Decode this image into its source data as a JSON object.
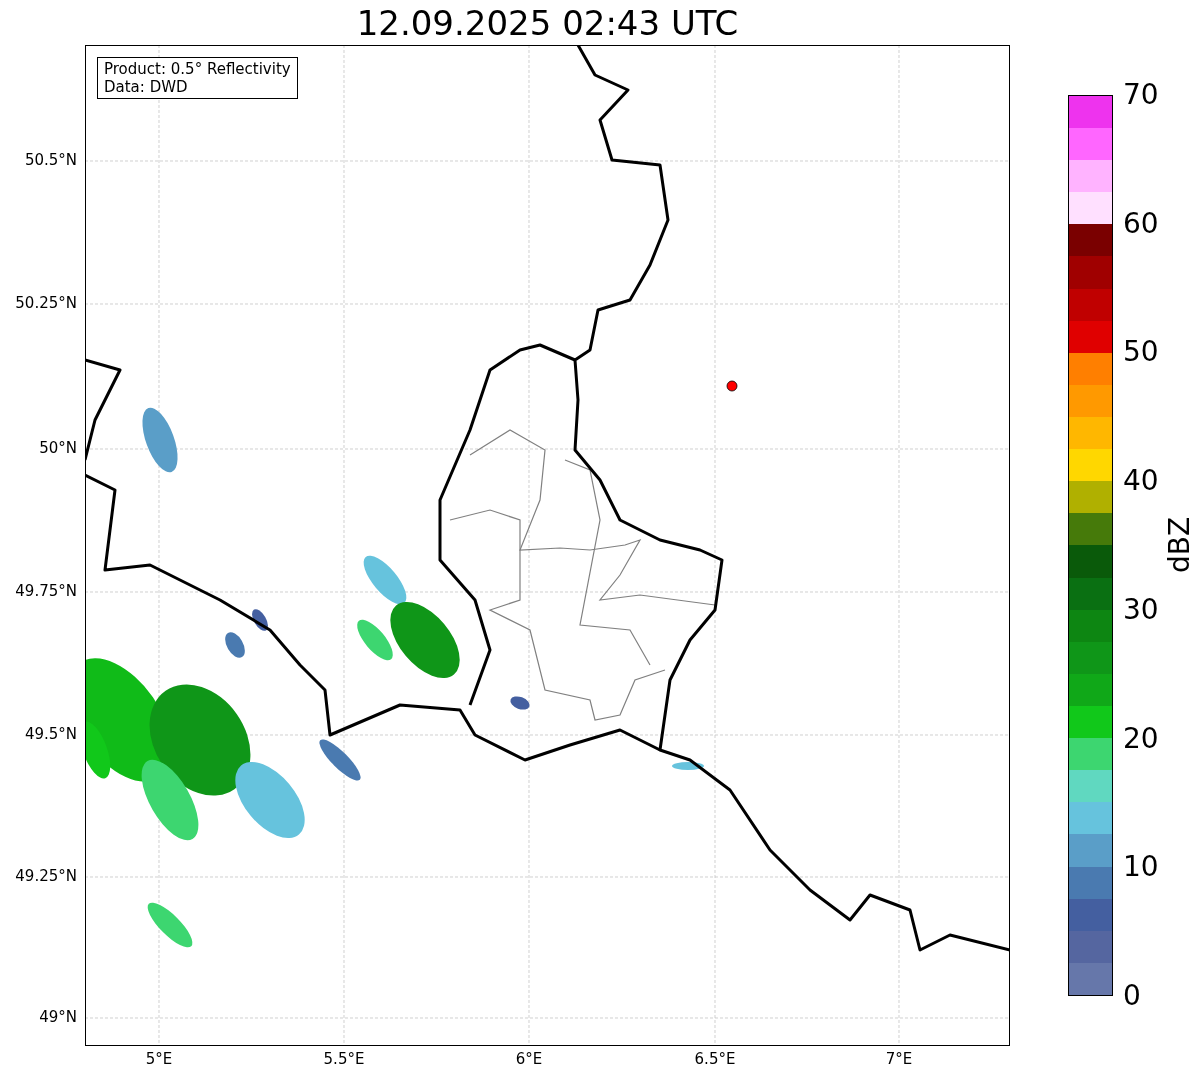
{
  "title": "12.09.2025 02:43 UTC",
  "info_box": {
    "lines": [
      "Product: 0.5° Reflectivity",
      "Data: DWD"
    ]
  },
  "y_ticks": [
    "50.5°N",
    "50.25°N",
    "50°N",
    "49.75°N",
    "49.5°N",
    "49.25°N",
    "49°N"
  ],
  "x_ticks": [
    "5°E",
    "5.5°E",
    "6°E",
    "6.5°E",
    "7°E"
  ],
  "colorbar": {
    "label": "dBZ",
    "ticks": [
      "70",
      "60",
      "50",
      "40",
      "30",
      "20",
      "10",
      "0"
    ],
    "segments": [
      {
        "color": "#6677aa"
      },
      {
        "color": "#5566a0"
      },
      {
        "color": "#445fa0"
      },
      {
        "color": "#4a7ab0"
      },
      {
        "color": "#5a9ec8"
      },
      {
        "color": "#66c3dd"
      },
      {
        "color": "#60d8c0"
      },
      {
        "color": "#3dd670"
      },
      {
        "color": "#11c81a"
      },
      {
        "color": "#10a818"
      },
      {
        "color": "#0f9618"
      },
      {
        "color": "#0d8612"
      },
      {
        "color": "#0a7012"
      },
      {
        "color": "#0a5a0a"
      },
      {
        "color": "#467a0a"
      },
      {
        "color": "#b0b000"
      },
      {
        "color": "#ffd700"
      },
      {
        "color": "#ffb700"
      },
      {
        "color": "#ff9900"
      },
      {
        "color": "#ff7f00"
      },
      {
        "color": "#e00000"
      },
      {
        "color": "#c00000"
      },
      {
        "color": "#a00000"
      },
      {
        "color": "#7a0000"
      },
      {
        "color": "#ffe0ff"
      },
      {
        "color": "#ffb3ff"
      },
      {
        "color": "#ff66ff"
      },
      {
        "color": "#ee33ee"
      }
    ]
  }
}
